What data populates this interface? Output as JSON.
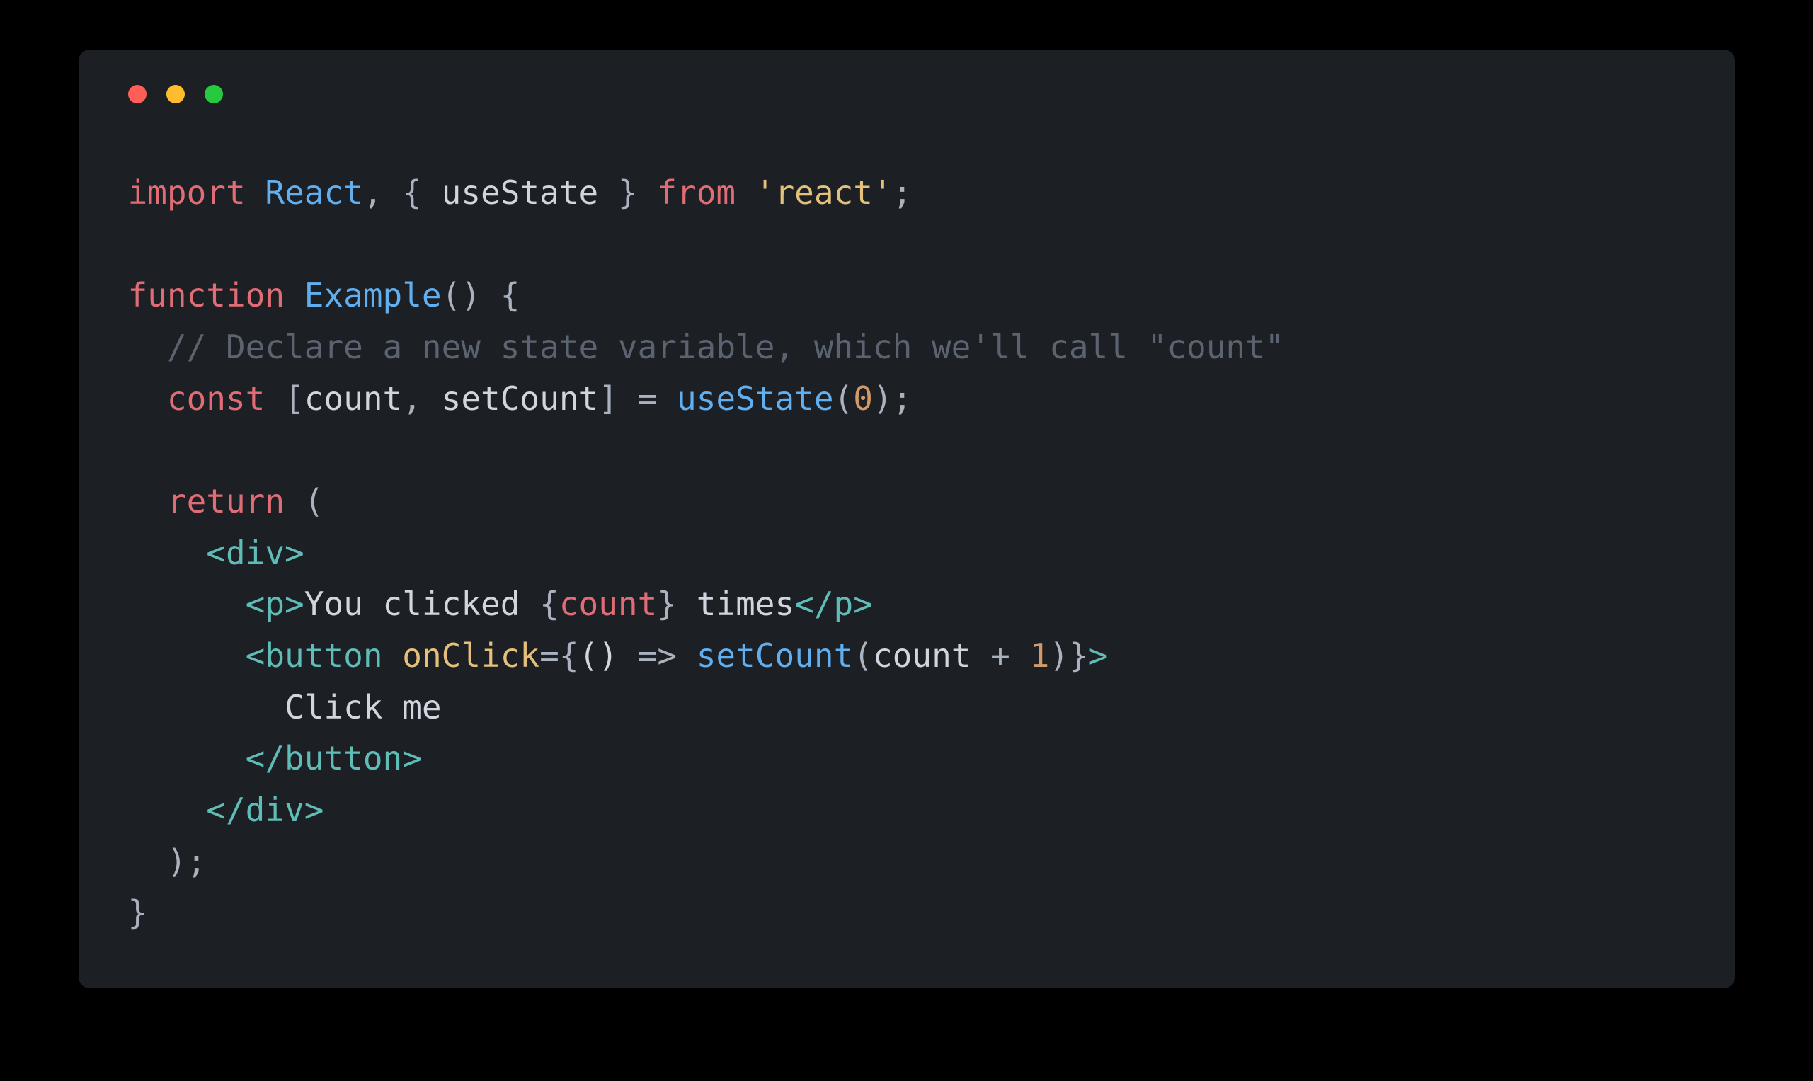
{
  "window": {
    "lights": [
      "red",
      "yellow",
      "green"
    ]
  },
  "code": {
    "line1": {
      "import_kw": "import",
      "react": "React",
      "comma": ",",
      "brace_open": " { ",
      "usestate": "useState",
      "brace_close": " } ",
      "from_kw": "from",
      "space1": " ",
      "module": "'react'",
      "semi": ";"
    },
    "line3": {
      "function_kw": "function",
      "space": " ",
      "name": "Example",
      "parens": "() {"
    },
    "line4": {
      "indent": "  ",
      "comment": "// Declare a new state variable, which we'll call \"count\""
    },
    "line5": {
      "indent": "  ",
      "const_kw": "const",
      "space1": " ",
      "bracket_open": "[",
      "count": "count",
      "comma": ", ",
      "setcount": "setCount",
      "bracket_close": "] = ",
      "usestate_call": "useState",
      "paren_open": "(",
      "zero": "0",
      "paren_close": ");"
    },
    "line7": {
      "indent": "  ",
      "return_kw": "return",
      "paren": " ("
    },
    "line8": {
      "indent": "    ",
      "div_open": "<div>"
    },
    "line9": {
      "indent": "      ",
      "p_open": "<p>",
      "text1": "You clicked ",
      "brace_open": "{",
      "count_var": "count",
      "brace_close": "}",
      "text2": " times",
      "p_close": "</p>"
    },
    "line10": {
      "indent": "      ",
      "button_open": "<button",
      "space": " ",
      "onclick": "onClick",
      "equals": "=",
      "brace_open": "{",
      "arrow_params": "() ",
      "arrow": "=>",
      "space2": " ",
      "setcount": "setCount",
      "paren_open": "(",
      "count_var": "count",
      "plus": " + ",
      "one": "1",
      "paren_close": ")",
      "brace_close": "}",
      "tag_close": ">"
    },
    "line11": {
      "indent": "        ",
      "text": "Click me"
    },
    "line12": {
      "indent": "      ",
      "button_close": "</button>"
    },
    "line13": {
      "indent": "    ",
      "div_close": "</div>"
    },
    "line14": {
      "indent": "  ",
      "close": ");"
    },
    "line15": {
      "brace": "}"
    }
  }
}
